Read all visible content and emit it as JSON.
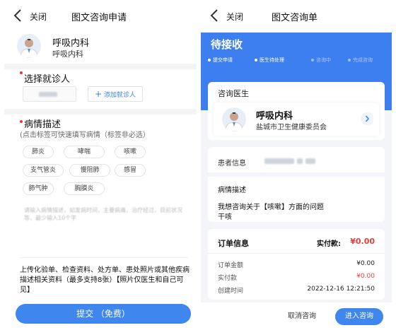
{
  "left": {
    "nav": {
      "close": "关闭",
      "title": "图文咨询申请"
    },
    "department": {
      "name": "呼吸内科",
      "sub": "呼吸内科"
    },
    "patient_section": {
      "title": "选择就诊人",
      "add_label": "添加就诊人"
    },
    "condition": {
      "title": "病情描述",
      "hint": "(点击标签可快速填写病情（标签非必选）",
      "tags": [
        "肺炎",
        "哮喘",
        "咳嗽",
        "支气管炎",
        "慢阻肺",
        "感冒",
        "肺气肿",
        "胸膜炎"
      ],
      "placeholder": "请输入病情描述，如发病时间，主要病痛，治疗经过，目前状况等，最少输入10个字"
    },
    "upload_note": "上传化验单、检查资料、处方单、患处照片或其他疾病描述相关资料（最多支持8张）【照片仅医生和自己可见】",
    "submit_label": "提交 （免费）"
  },
  "right": {
    "nav": {
      "close": "关闭",
      "title": "图文咨询单"
    },
    "status": "待接收",
    "steps": [
      {
        "label": "提交申请",
        "active": true
      },
      {
        "label": "医生待处理",
        "active": true
      },
      {
        "label": "咨询中",
        "active": false
      },
      {
        "label": "完成咨询",
        "active": false
      }
    ],
    "doctor_card": {
      "label": "咨询医生",
      "name": "呼吸内科",
      "org": "盐城市卫生健康委员会"
    },
    "patient_info_label": "患者信息",
    "condition": {
      "label": "病情描述",
      "line1": "我想咨询关于【咳嗽】方面的问题",
      "line2": "干咳"
    },
    "order": {
      "title": "订单信息",
      "paid_label": "实付款:",
      "paid_value": "¥0.00",
      "rows": [
        {
          "label": "订单金额",
          "value": "¥0.00",
          "color": "#222222"
        },
        {
          "label": "实付款",
          "value": "¥0.00",
          "color": "#e63c3c"
        },
        {
          "label": "创建时间",
          "value": "2022-12-16 12:21:50",
          "color": "#222222"
        }
      ]
    },
    "buttons": {
      "cancel": "取消咨询",
      "enter": "进入咨询"
    }
  },
  "colors": {
    "accent": "#3f86ee",
    "header": "#3e7ff0",
    "price": "#e63c3c"
  }
}
